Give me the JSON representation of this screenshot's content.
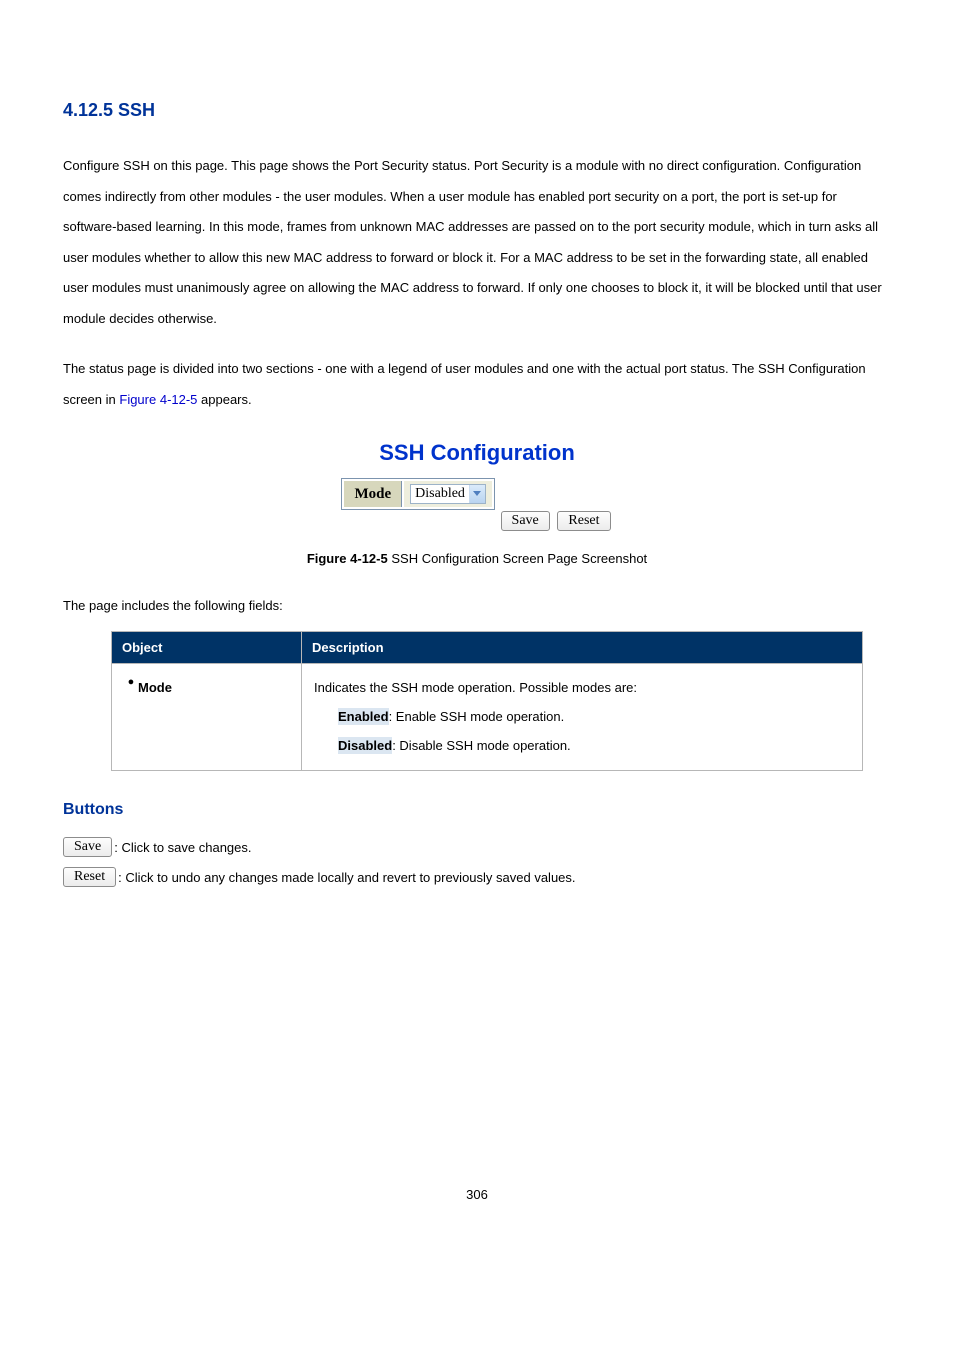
{
  "section_heading": "4.12.5 SSH",
  "paragraph1": "Configure SSH on this page. This page shows the Port Security status. Port Security is a module with no direct configuration. Configuration comes indirectly from other modules - the user modules. When a user module has enabled port security on a port, the port is set-up for software-based learning. In this mode, frames from unknown MAC addresses are passed on to the port security module, which in turn asks all user modules whether to allow this new MAC address to forward or block it. For a MAC address to be set in the forwarding state, all enabled user modules must unanimously agree on allowing the MAC address to forward. If only one chooses to block it, it will be blocked until that user module decides otherwise.",
  "paragraph2_a": "The status page is divided into two sections - one with a legend of user modules and one with the actual port status. The SSH Configuration screen in ",
  "figure_link": "Figure 4-12-5",
  "paragraph2_b": " appears.",
  "widget": {
    "title": "SSH Configuration",
    "mode_label": "Mode",
    "mode_value": "Disabled",
    "save": "Save",
    "reset": "Reset"
  },
  "caption": {
    "figno": "Figure 4-12-5",
    "text": " SSH Configuration Screen Page Screenshot"
  },
  "fields_intro": "The page includes the following fields:",
  "table": {
    "h_object": "Object",
    "h_desc": "Description",
    "obj1": "Mode",
    "desc1": "Indicates the SSH mode operation. Possible modes are:",
    "enabled_label": "Enabled",
    "enabled_text": ": Enable SSH mode operation.",
    "disabled_label": "Disabled",
    "disabled_text": ": Disable SSH mode operation."
  },
  "buttons": {
    "heading": "Buttons",
    "save_desc": ": Click to save changes.",
    "reset_desc": ": Click to undo any changes made locally and revert to previously saved values."
  },
  "page_num": "306"
}
